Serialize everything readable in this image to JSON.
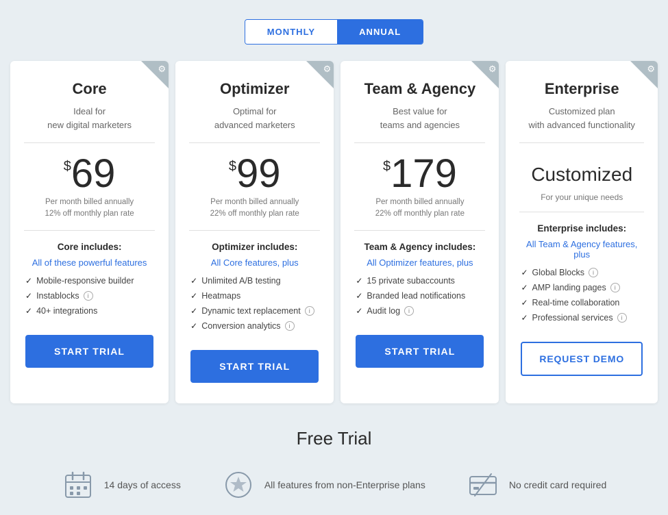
{
  "billing_toggle": {
    "monthly_label": "MONTHLY",
    "annual_label": "ANNUAL",
    "active": "annual"
  },
  "plans": [
    {
      "id": "core",
      "name": "Core",
      "desc_line1": "Ideal for",
      "desc_line2": "new digital marketers",
      "price": "69",
      "price_sub_line1": "Per month billed annually",
      "price_sub_line2": "12% off monthly plan rate",
      "includes_title": "Core includes:",
      "features_link": "All of these powerful features",
      "features": [
        {
          "text": "Mobile-responsive builder",
          "info": false
        },
        {
          "text": "Instablocks",
          "info": true
        },
        {
          "text": "40+ integrations",
          "info": false
        }
      ],
      "btn_label": "START TRIAL",
      "btn_type": "primary"
    },
    {
      "id": "optimizer",
      "name": "Optimizer",
      "desc_line1": "Optimal for",
      "desc_line2": "advanced marketers",
      "price": "99",
      "price_sub_line1": "Per month billed annually",
      "price_sub_line2": "22% off monthly plan rate",
      "includes_title": "Optimizer includes:",
      "features_link": "All Core features, plus",
      "features": [
        {
          "text": "Unlimited A/B testing",
          "info": false
        },
        {
          "text": "Heatmaps",
          "info": false
        },
        {
          "text": "Dynamic text replacement",
          "info": true
        },
        {
          "text": "Conversion analytics",
          "info": true
        }
      ],
      "btn_label": "START TRIAL",
      "btn_type": "primary"
    },
    {
      "id": "team-agency",
      "name": "Team & Agency",
      "desc_line1": "Best value for",
      "desc_line2": "teams and agencies",
      "price": "179",
      "price_sub_line1": "Per month billed annually",
      "price_sub_line2": "22% off monthly plan rate",
      "includes_title": "Team & Agency includes:",
      "features_link": "All Optimizer features, plus",
      "features": [
        {
          "text": "15 private subaccounts",
          "info": false
        },
        {
          "text": "Branded lead notifications",
          "info": false
        },
        {
          "text": "Audit log",
          "info": true
        }
      ],
      "btn_label": "START TRIAL",
      "btn_type": "primary"
    },
    {
      "id": "enterprise",
      "name": "Enterprise",
      "desc_line1": "Customized plan",
      "desc_line2": "with advanced functionality",
      "price_customized": "Customized",
      "price_unique": "For your unique needs",
      "includes_title": "Enterprise includes:",
      "features_link": "All Team & Agency features, plus",
      "features": [
        {
          "text": "Global Blocks",
          "info": true
        },
        {
          "text": "AMP landing pages",
          "info": true
        },
        {
          "text": "Real-time collaboration",
          "info": false
        },
        {
          "text": "Professional services",
          "info": true
        }
      ],
      "btn_label": "REQUEST DEMO",
      "btn_type": "outline"
    }
  ],
  "free_trial": {
    "title": "Free Trial",
    "features": [
      {
        "id": "access",
        "label": "14 days of access"
      },
      {
        "id": "features",
        "label": "All features from non-Enterprise plans"
      },
      {
        "id": "no-card",
        "label": "No credit card required"
      }
    ]
  }
}
